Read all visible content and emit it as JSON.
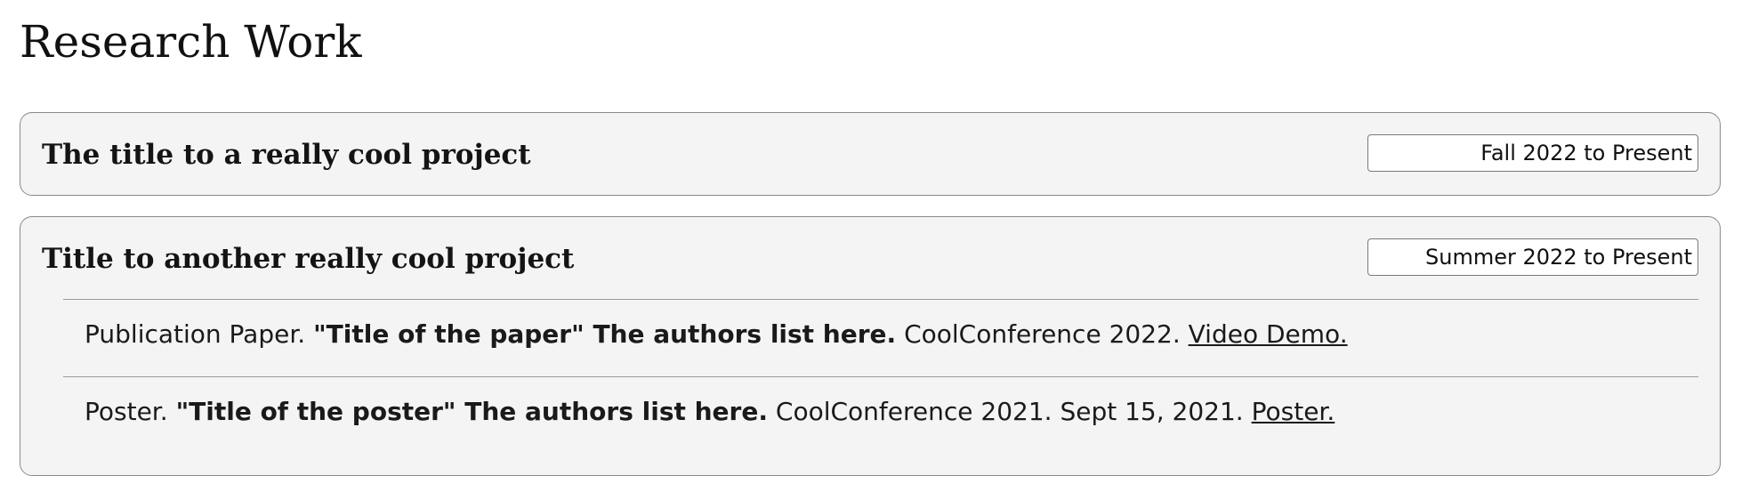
{
  "page": {
    "title": "Research Work"
  },
  "projects": [
    {
      "title": "The title to a really cool project",
      "date": "Fall 2022 to Present",
      "items": []
    },
    {
      "title": "Title to another really cool project",
      "date": "Summer 2022 to Present",
      "items": [
        {
          "type": "Publication Paper.",
          "title_authors": "\"Title of the paper\" The authors list here.",
          "venue": "CoolConference 2022.",
          "link": "Video Demo."
        },
        {
          "type": "Poster.",
          "title_authors": "\"Title of the poster\" The authors list here.",
          "venue": "CoolConference 2021. Sept 15, 2021.",
          "link": "Poster."
        }
      ]
    }
  ]
}
